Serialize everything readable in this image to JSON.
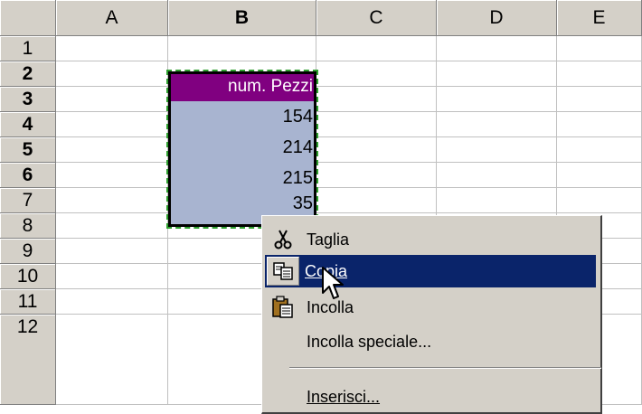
{
  "columns": [
    "A",
    "B",
    "C",
    "D",
    "E"
  ],
  "rows": [
    "1",
    "2",
    "3",
    "4",
    "5",
    "6",
    "7",
    "8",
    "9",
    "10",
    "11",
    "12"
  ],
  "cells": {
    "B2": "num. Pezzi",
    "B3": "154",
    "B4": "214",
    "B5": "215",
    "B6": "35"
  },
  "context_menu": {
    "items": [
      {
        "label": "Taglia",
        "icon": "scissors-icon"
      },
      {
        "label": "Copia",
        "icon": "copy-icon"
      },
      {
        "label": "Incolla",
        "icon": "paste-icon"
      },
      {
        "label": "Incolla speciale...",
        "icon": ""
      },
      {
        "label": "Inserisci...",
        "icon": ""
      }
    ]
  },
  "colors": {
    "header_bg": "#d4d0c8",
    "selection": "#a8b4d0",
    "header_cell": "#800080",
    "menu_highlight": "#0a246a"
  }
}
